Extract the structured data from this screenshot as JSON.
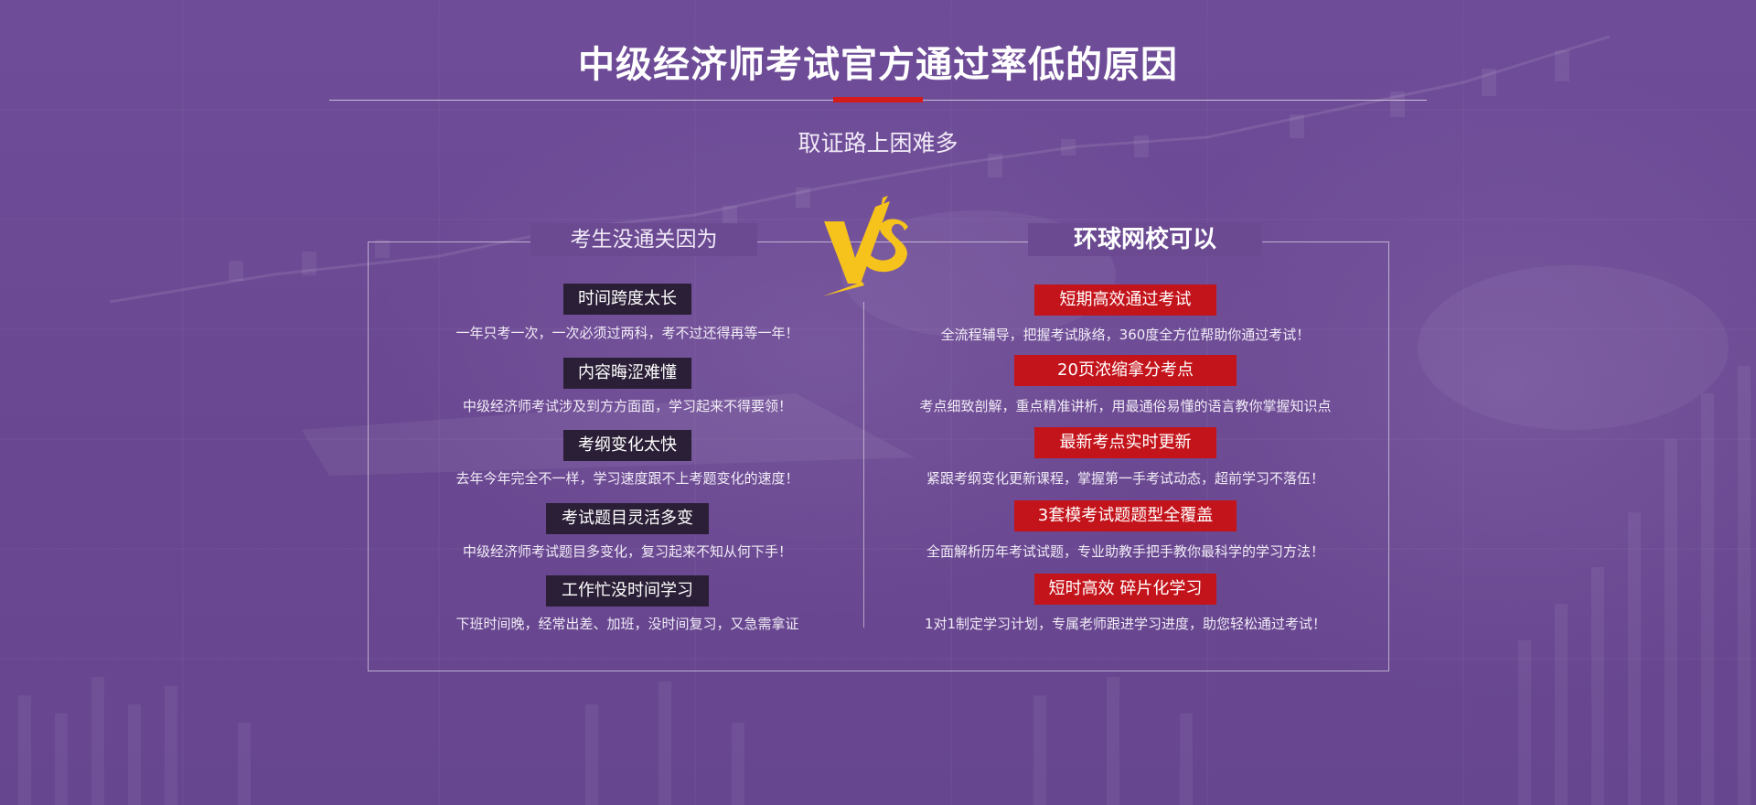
{
  "header": {
    "title": "中级经济师考试官方通过率低的原因",
    "subtitle": "取证路上困难多"
  },
  "left": {
    "heading": "考生没通关因为",
    "items": [
      {
        "title": "时间跨度太长",
        "desc": "一年只考一次，一次必须过两科，考不过还得再等一年！"
      },
      {
        "title": "内容晦涩难懂",
        "desc": "中级经济师考试涉及到方方面面，学习起来不得要领！"
      },
      {
        "title": "考纲变化太快",
        "desc": "去年今年完全不一样，学习速度跟不上考题变化的速度！"
      },
      {
        "title": "考试题目灵活多变",
        "desc": "中级经济师考试题目多变化，复习起来不知从何下手！"
      },
      {
        "title": "工作忙没时间学习",
        "desc": "下班时间晚，经常出差、加班，没时间复习，又急需拿证"
      }
    ]
  },
  "right": {
    "heading": "环球网校可以",
    "items": [
      {
        "title": "短期高效通过考试",
        "desc": "全流程辅导，把握考试脉络，360度全方位帮助你通过考试！"
      },
      {
        "title": "20页浓缩拿分考点",
        "desc": "考点细致剖解，重点精准讲析，用最通俗易懂的语言教你掌握知识点"
      },
      {
        "title": "最新考点实时更新",
        "desc": "紧跟考纲变化更新课程，掌握第一手考试动态，超前学习不落伍！"
      },
      {
        "title": "3套模考试题题型全覆盖",
        "desc": "全面解析历年考试试题，专业助教手把手教你最科学的学习方法！"
      },
      {
        "title": "短时高效 碎片化学习",
        "desc": "1对1制定学习计划，专属老师跟进学习进度，助您轻松通过考试！"
      }
    ]
  },
  "vs_label": "VS",
  "colors": {
    "background": "#6b4a92",
    "accent_red": "#c4141b",
    "dark_tag": "#2a1f36",
    "vs_yellow": "#f6c21c"
  }
}
